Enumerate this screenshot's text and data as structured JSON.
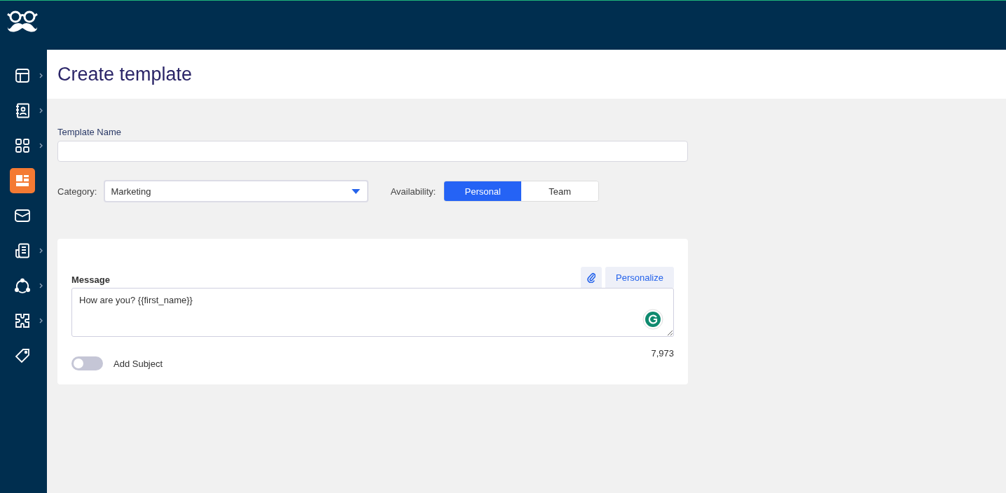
{
  "sidebar": {
    "items": [
      {
        "kind": "layout",
        "expandable": true,
        "selected": false
      },
      {
        "kind": "contacts",
        "expandable": true,
        "selected": false
      },
      {
        "kind": "grid",
        "expandable": true,
        "selected": false
      },
      {
        "kind": "template",
        "expandable": false,
        "selected": true
      },
      {
        "kind": "mail",
        "expandable": false,
        "selected": false
      },
      {
        "kind": "document",
        "expandable": true,
        "selected": false
      },
      {
        "kind": "network",
        "expandable": true,
        "selected": false
      },
      {
        "kind": "puzzle",
        "expandable": true,
        "selected": false
      },
      {
        "kind": "tag",
        "expandable": false,
        "selected": false
      }
    ]
  },
  "page": {
    "title": "Create template"
  },
  "template_name": {
    "label": "Template Name"
  },
  "category": {
    "label": "Category:",
    "value": "Marketing"
  },
  "availability": {
    "label": "Availability:",
    "options": [
      {
        "label": "Personal",
        "selected": true
      },
      {
        "label": "Team",
        "selected": false
      }
    ]
  },
  "message": {
    "label": "Message",
    "personalize": "Personalize",
    "value": "How are you? {{first_name}}",
    "count": "7,973"
  },
  "add_subject": {
    "label": "Add Subject",
    "on": false
  }
}
